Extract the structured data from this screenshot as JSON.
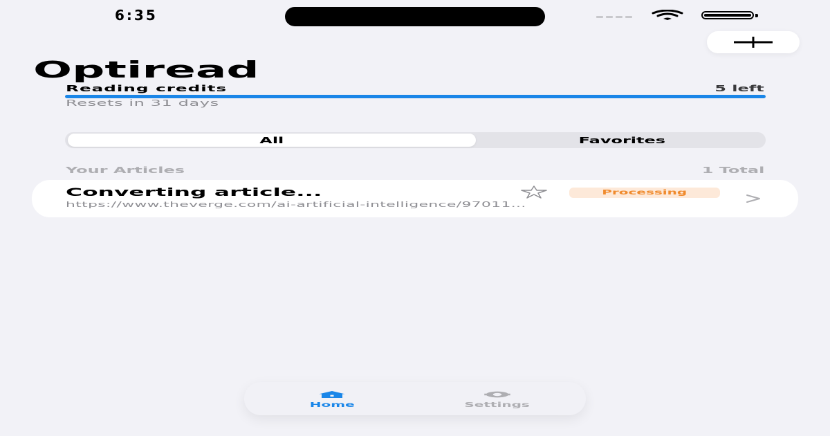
{
  "status_bar": {
    "time": "6:35"
  },
  "header": {
    "title": "Optiread",
    "add_icon": "plus-icon"
  },
  "credits": {
    "label": "Reading credits",
    "remaining": "5 left",
    "progress": 1.0,
    "reset_text": "Resets in 31 days"
  },
  "filter": {
    "options": [
      "All",
      "Favorites"
    ],
    "selected": "All"
  },
  "articles": {
    "section_label": "Your Articles",
    "count_label": "1 Total",
    "items": [
      {
        "title": "Converting article...",
        "url": "https://www.theverge.com/ai-artificial-intelligence/97011...",
        "status": "Processing",
        "favorite_icon": "star-outline-icon",
        "chevron_icon": "chevron-right-icon"
      }
    ]
  },
  "tabbar": {
    "tabs": [
      {
        "label": "Home",
        "icon": "house-icon",
        "active": true
      },
      {
        "label": "Settings",
        "icon": "gear-icon",
        "active": false
      }
    ]
  },
  "colors": {
    "accent": "#1a86e8",
    "background": "#f2f2f7",
    "badge_bg": "#fde9d9",
    "badge_text": "#f08a2c"
  }
}
